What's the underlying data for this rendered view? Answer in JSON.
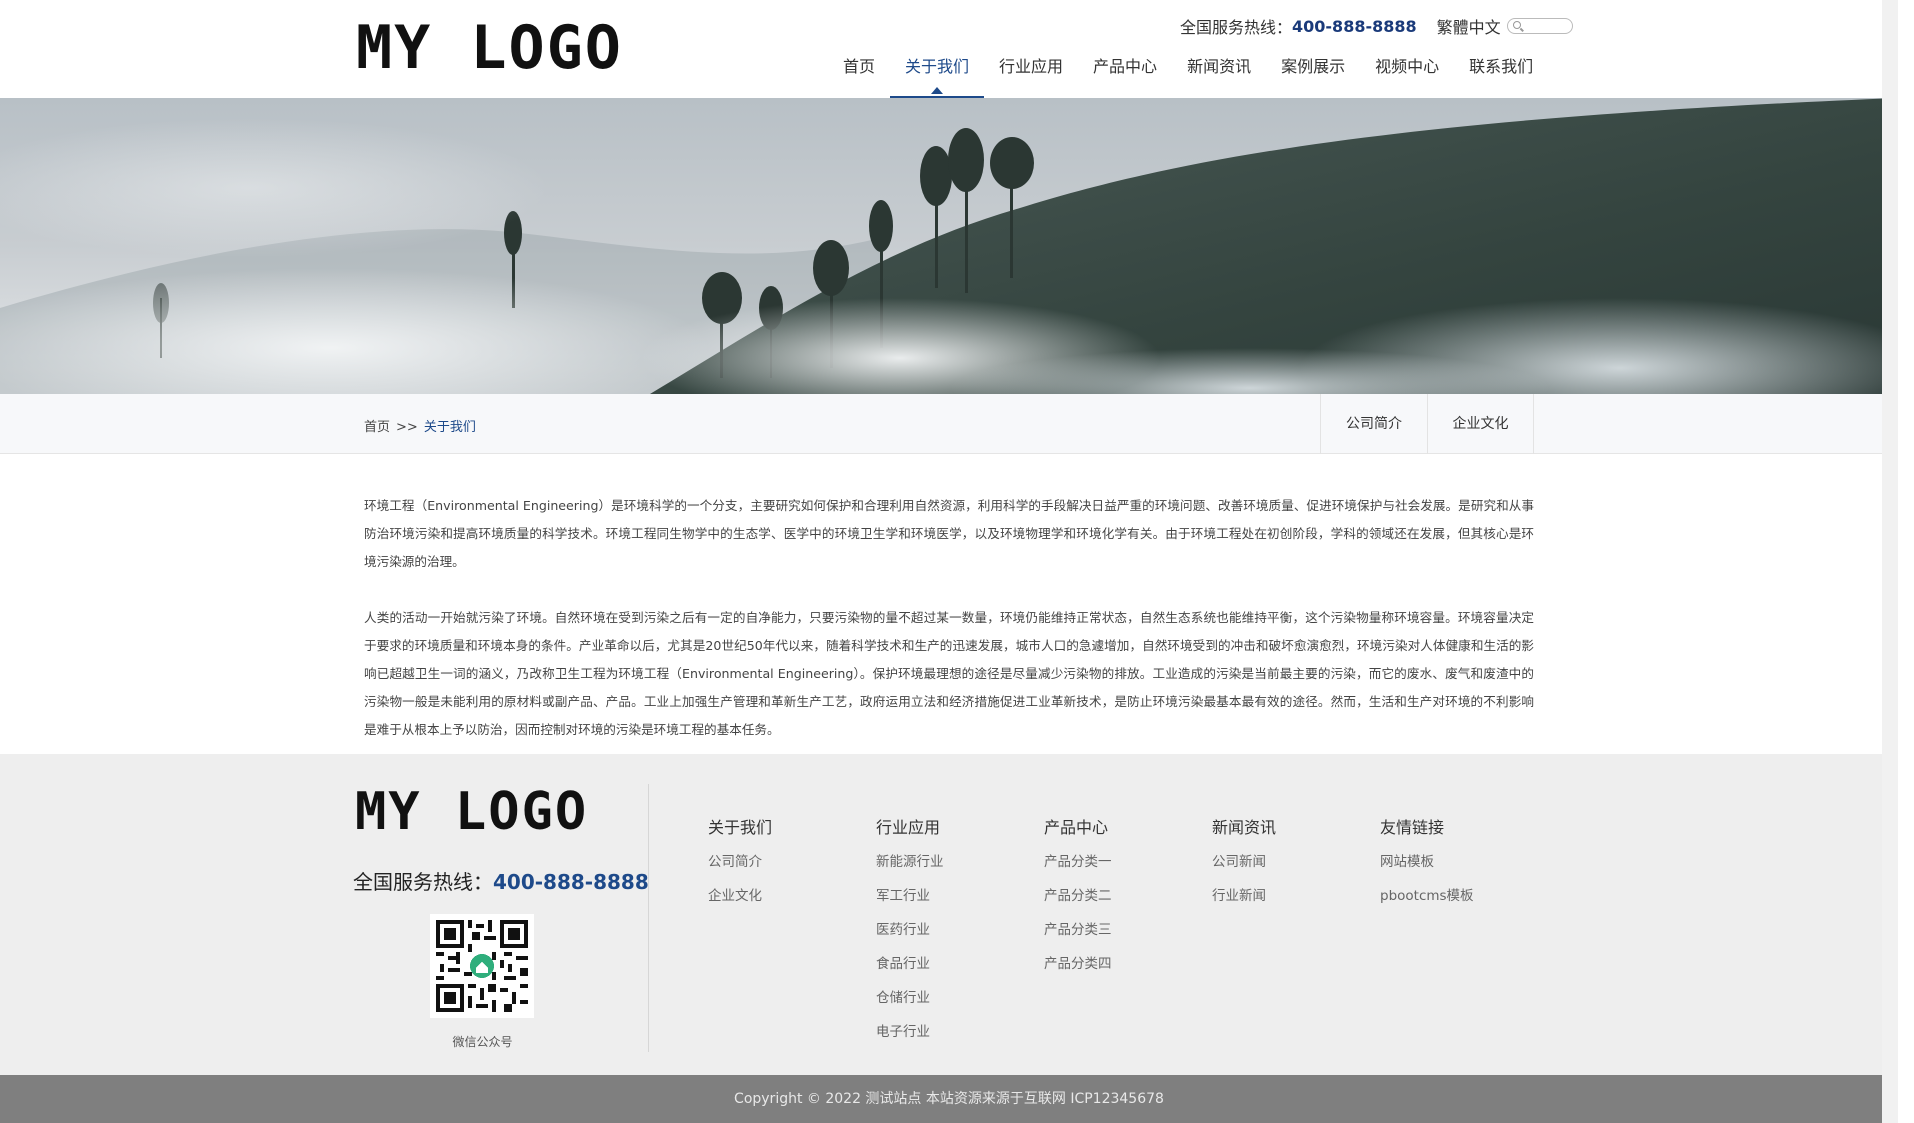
{
  "header": {
    "logo_text": "MY LOGO",
    "hotline_label": "全国服务热线：",
    "hotline_number": "400-888-8888",
    "lang_switch": "繁體中文",
    "nav": [
      {
        "label": "首页",
        "active": false
      },
      {
        "label": "关于我们",
        "active": true
      },
      {
        "label": "行业应用",
        "active": false
      },
      {
        "label": "产品中心",
        "active": false
      },
      {
        "label": "新闻资讯",
        "active": false
      },
      {
        "label": "案例展示",
        "active": false
      },
      {
        "label": "视频中心",
        "active": false
      },
      {
        "label": "联系我们",
        "active": false
      }
    ]
  },
  "breadcrumb": {
    "home": "首页",
    "separator": ">>",
    "current": "关于我们"
  },
  "subtabs": [
    "公司简介",
    "企业文化"
  ],
  "content": {
    "paragraphs": [
      "环境工程（Environmental Engineering）是环境科学的一个分支，主要研究如何保护和合理利用自然资源，利用科学的手段解决日益严重的环境问题、改善环境质量、促进环境保护与社会发展。是研究和从事防治环境污染和提高环境质量的科学技术。环境工程同生物学中的生态学、医学中的环境卫生学和环境医学，以及环境物理学和环境化学有关。由于环境工程处在初创阶段，学科的领域还在发展，但其核心是环境污染源的治理。",
      "人类的活动一开始就污染了环境。自然环境在受到污染之后有一定的自净能力，只要污染物的量不超过某一数量，环境仍能维持正常状态，自然生态系统也能维持平衡，这个污染物量称环境容量。环境容量决定于要求的环境质量和环境本身的条件。产业革命以后，尤其是20世纪50年代以来，随着科学技术和生产的迅速发展，城市人口的急遽增加，自然环境受到的冲击和破坏愈演愈烈，环境污染对人体健康和生活的影响已超越卫生一词的涵义，乃改称卫生工程为环境工程（Environmental Engineering）。保护环境最理想的途径是尽量减少污染物的排放。工业造成的污染是当前最主要的污染，而它的废水、废气和废渣中的污染物一般是未能利用的原材料或副产品、产品。工业上加强生产管理和革新生产工艺，政府运用立法和经济措施促进工业革新技术，是防止环境污染最基本最有效的途径。然而，生活和生产对环境的不利影响是难于从根本上予以防治，因而控制对环境的污染是环境工程的基本任务。"
    ]
  },
  "footer": {
    "logo_text": "MY LOGO",
    "hotline_label": "全国服务热线：",
    "hotline_number": "400-888-8888",
    "qr_caption": "微信公众号",
    "columns": [
      {
        "title": "关于我们",
        "links": [
          "公司简介",
          "企业文化"
        ]
      },
      {
        "title": "行业应用",
        "links": [
          "新能源行业",
          "军工行业",
          "医药行业",
          "食品行业",
          "仓储行业",
          "电子行业"
        ]
      },
      {
        "title": "产品中心",
        "links": [
          "产品分类一",
          "产品分类二",
          "产品分类三",
          "产品分类四"
        ]
      },
      {
        "title": "新闻资讯",
        "links": [
          "公司新闻",
          "行业新闻"
        ]
      },
      {
        "title": "友情链接",
        "links": [
          "网站模板",
          "pbootcms模板"
        ]
      }
    ],
    "copyright": "Copyright © 2022 测试站点 本站资源来源于互联网  ICP12345678"
  },
  "colors": {
    "accent": "#1e4a8a",
    "footer_bg": "#eeeeee",
    "bottom_bar": "#7f7f7f"
  }
}
